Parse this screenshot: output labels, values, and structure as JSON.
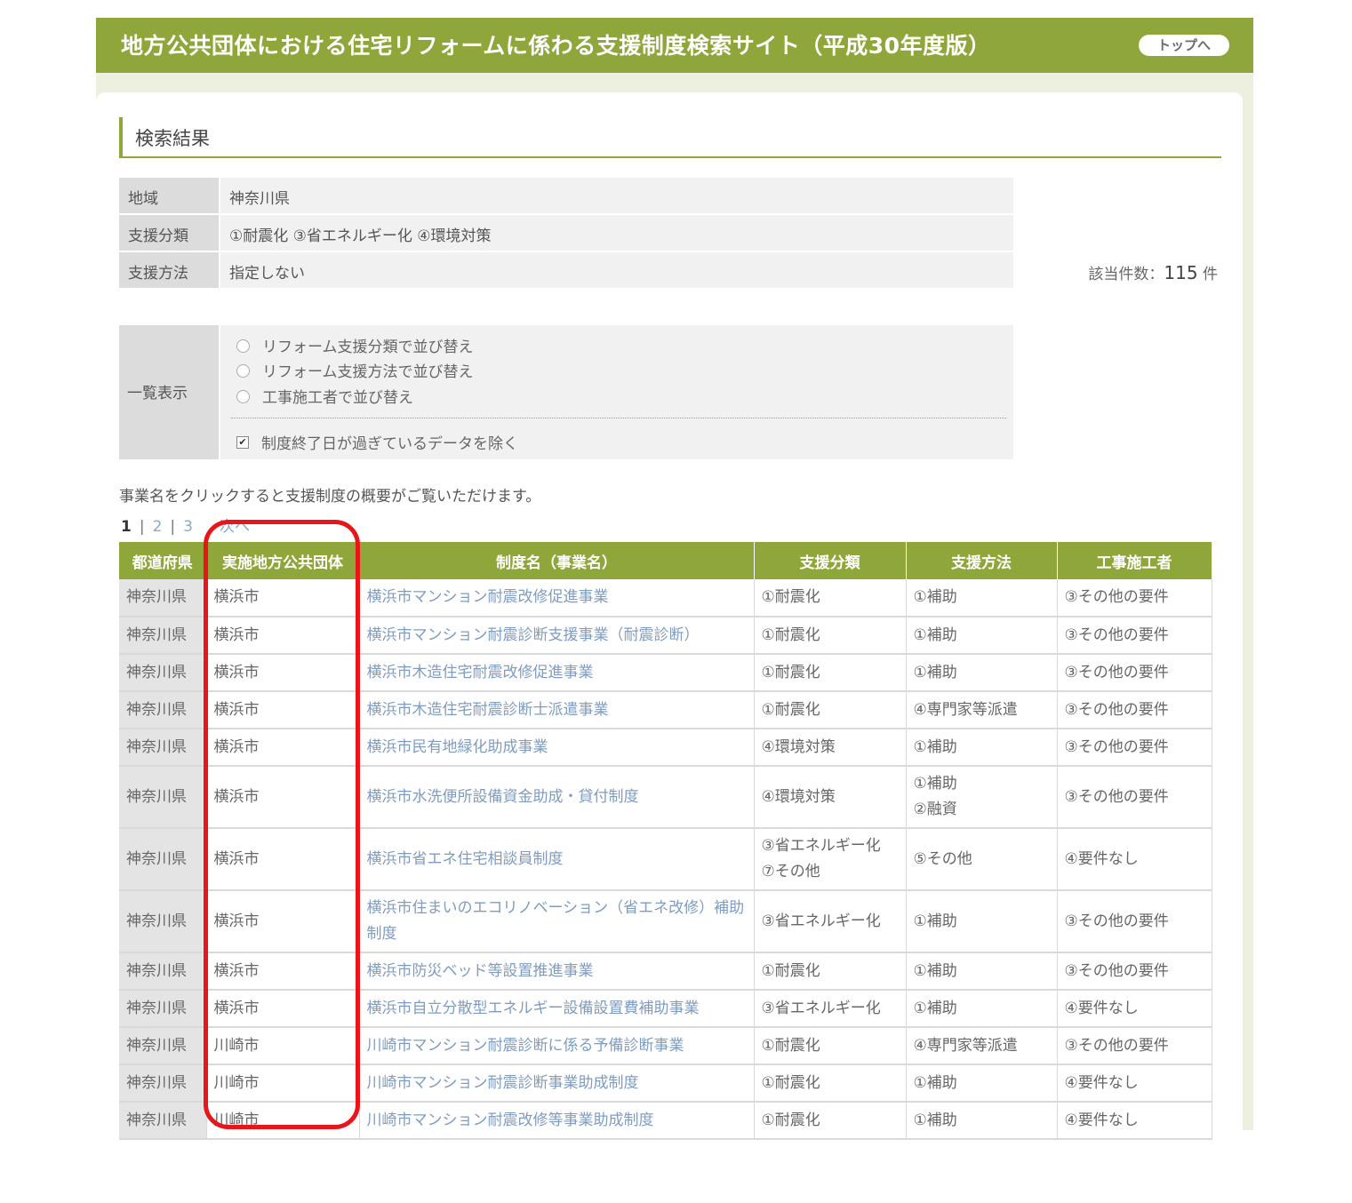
{
  "header": {
    "site_title": "地方公共団体における住宅リフォームに係わる支援制度検索サイト（平成30年度版）",
    "top_button": "トップへ"
  },
  "section_title": "検索結果",
  "conditions": [
    {
      "label": "地域",
      "value": "神奈川県"
    },
    {
      "label": "支援分類",
      "value": "①耐震化 ③省エネルギー化 ④環境対策"
    },
    {
      "label": "支援方法",
      "value": "指定しない"
    }
  ],
  "count": {
    "label": "該当件数：",
    "value": "115",
    "unit": "件"
  },
  "display": {
    "label": "一覧表示",
    "sort_options": [
      "リフォーム支援分類で並び替え",
      "リフォーム支援方法で並び替え",
      "工事施工者で並び替え"
    ],
    "exclude_checkbox": {
      "label": "制度終了日が過ぎているデータを除く",
      "checked": true
    }
  },
  "hint": "事業名をクリックすると支援制度の概要がご覧いただけます。",
  "pager": {
    "current": "1",
    "pages": [
      "2",
      "3"
    ],
    "next": "次へ",
    "separator": "|"
  },
  "table": {
    "headers": [
      "都道府県",
      "実施地方公共団体",
      "制度名（事業名）",
      "支援分類",
      "支援方法",
      "工事施工者"
    ],
    "rows": [
      {
        "pref": "神奈川県",
        "city": "横浜市",
        "name": "横浜市マンション耐震改修促進事業",
        "category": [
          "①耐震化"
        ],
        "method": [
          "①補助"
        ],
        "builder": "③その他の要件"
      },
      {
        "pref": "神奈川県",
        "city": "横浜市",
        "name": "横浜市マンション耐震診断支援事業（耐震診断）",
        "category": [
          "①耐震化"
        ],
        "method": [
          "①補助"
        ],
        "builder": "③その他の要件"
      },
      {
        "pref": "神奈川県",
        "city": "横浜市",
        "name": "横浜市木造住宅耐震改修促進事業",
        "category": [
          "①耐震化"
        ],
        "method": [
          "①補助"
        ],
        "builder": "③その他の要件"
      },
      {
        "pref": "神奈川県",
        "city": "横浜市",
        "name": "横浜市木造住宅耐震診断士派遣事業",
        "category": [
          "①耐震化"
        ],
        "method": [
          "④専門家等派遣"
        ],
        "builder": "③その他の要件"
      },
      {
        "pref": "神奈川県",
        "city": "横浜市",
        "name": "横浜市民有地緑化助成事業",
        "category": [
          "④環境対策"
        ],
        "method": [
          "①補助"
        ],
        "builder": "③その他の要件"
      },
      {
        "pref": "神奈川県",
        "city": "横浜市",
        "name": "横浜市水洗便所設備資金助成・貸付制度",
        "category": [
          "④環境対策"
        ],
        "method": [
          "①補助",
          "②融資"
        ],
        "builder": "③その他の要件"
      },
      {
        "pref": "神奈川県",
        "city": "横浜市",
        "name": "横浜市省エネ住宅相談員制度",
        "category": [
          "③省エネルギー化",
          "⑦その他"
        ],
        "method": [
          "⑤その他"
        ],
        "builder": "④要件なし"
      },
      {
        "pref": "神奈川県",
        "city": "横浜市",
        "name": "横浜市住まいのエコリノベーション（省エネ改修）補助制度",
        "category": [
          "③省エネルギー化"
        ],
        "method": [
          "①補助"
        ],
        "builder": "③その他の要件"
      },
      {
        "pref": "神奈川県",
        "city": "横浜市",
        "name": "横浜市防災ベッド等設置推進事業",
        "category": [
          "①耐震化"
        ],
        "method": [
          "①補助"
        ],
        "builder": "③その他の要件"
      },
      {
        "pref": "神奈川県",
        "city": "横浜市",
        "name": "横浜市自立分散型エネルギー設備設置費補助事業",
        "category": [
          "③省エネルギー化"
        ],
        "method": [
          "①補助"
        ],
        "builder": "④要件なし"
      },
      {
        "pref": "神奈川県",
        "city": "川崎市",
        "name": "川崎市マンション耐震診断に係る予備診断事業",
        "category": [
          "①耐震化"
        ],
        "method": [
          "④専門家等派遣"
        ],
        "builder": "③その他の要件"
      },
      {
        "pref": "神奈川県",
        "city": "川崎市",
        "name": "川崎市マンション耐震診断事業助成制度",
        "category": [
          "①耐震化"
        ],
        "method": [
          "①補助"
        ],
        "builder": "④要件なし"
      },
      {
        "pref": "神奈川県",
        "city": "川崎市",
        "name": "川崎市マンション耐震改修等事業助成制度",
        "category": [
          "①耐震化"
        ],
        "method": [
          "①補助"
        ],
        "builder": "④要件なし"
      }
    ]
  },
  "colors": {
    "header_green": "#8ea63a",
    "highlight_red": "#e8161b",
    "link_blue": "#7f9cc0"
  }
}
